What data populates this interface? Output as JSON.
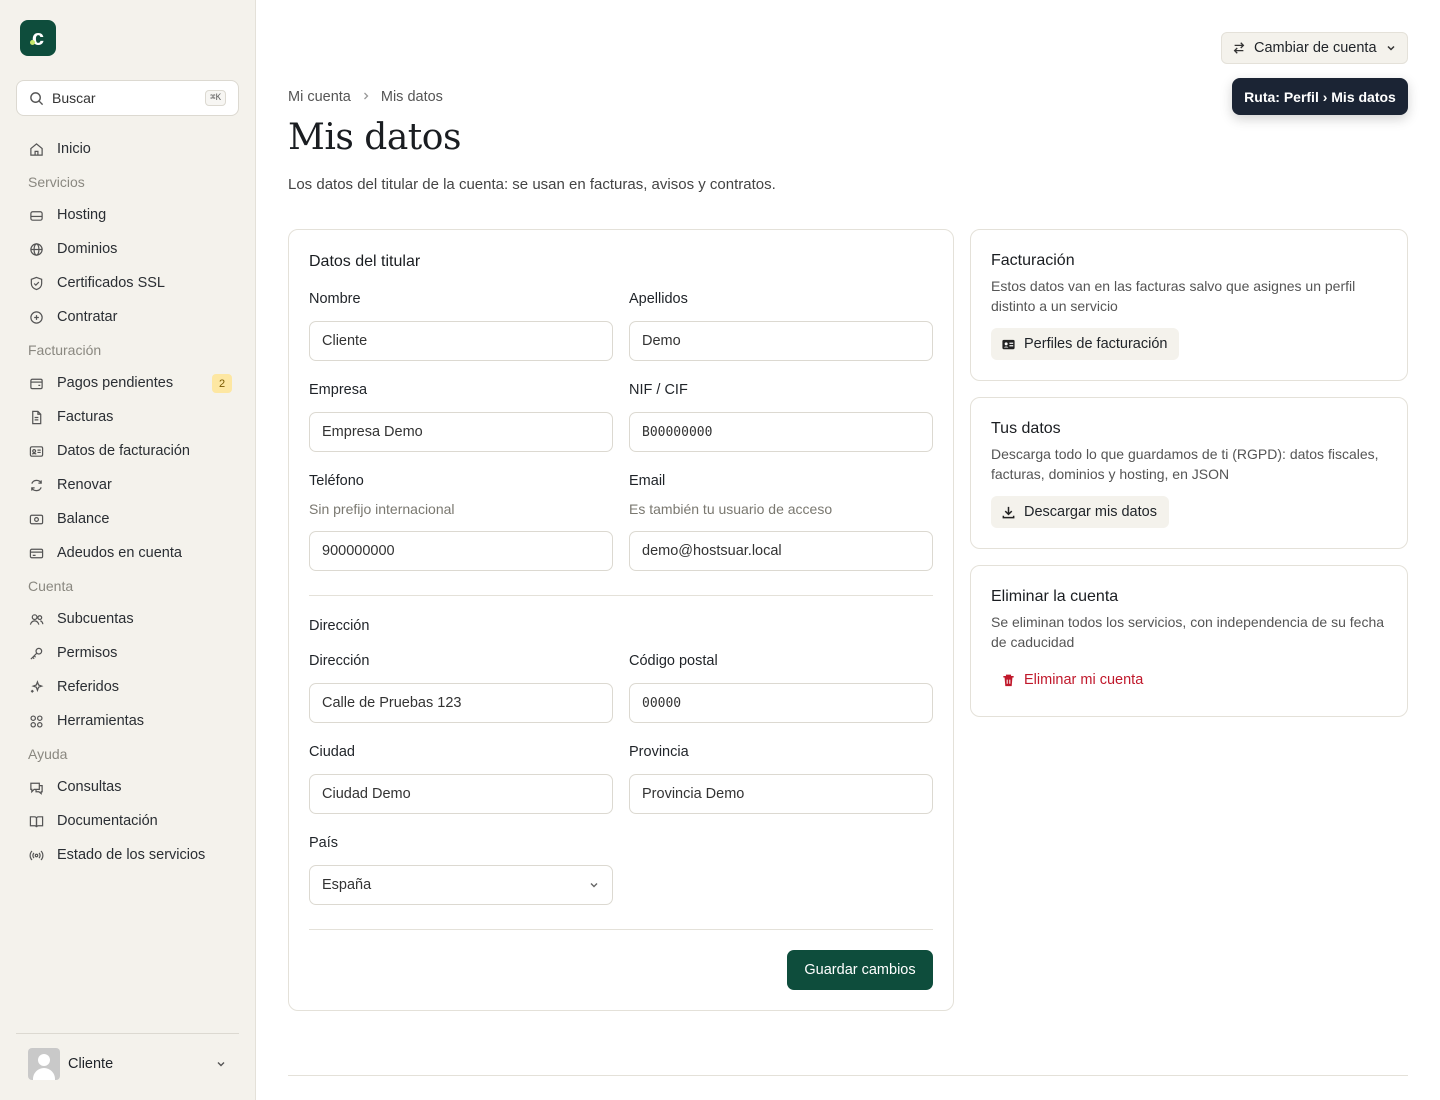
{
  "brand": {
    "logo_letter": "c",
    "accent": "#0e4d3c"
  },
  "search": {
    "placeholder": "Buscar",
    "shortcut": "⌘K"
  },
  "sidebar": {
    "home": "Inicio",
    "sections": {
      "servicios": "Servicios",
      "facturacion": "Facturación",
      "cuenta": "Cuenta",
      "ayuda": "Ayuda"
    },
    "items": {
      "hosting": "Hosting",
      "dominios": "Dominios",
      "ssl": "Certificados SSL",
      "contratar": "Contratar",
      "pagos": "Pagos pendientes",
      "pagos_badge": "2",
      "facturas": "Facturas",
      "datos_facturacion": "Datos de facturación",
      "renovar": "Renovar",
      "balance": "Balance",
      "adeudos": "Adeudos en cuenta",
      "subcuentas": "Subcuentas",
      "permisos": "Permisos",
      "referidos": "Referidos",
      "herramientas": "Herramientas",
      "consultas": "Consultas",
      "documentacion": "Documentación",
      "estado": "Estado de los servicios"
    },
    "user": {
      "name": "Cliente"
    }
  },
  "header": {
    "switch_account": "Cambiar de cuenta",
    "tooltip": "Ruta: Perfil › Mis datos"
  },
  "breadcrumb": {
    "parent": "Mi cuenta",
    "current": "Mis datos"
  },
  "page": {
    "title": "Mis datos",
    "subtitle": "Los datos del titular de la cuenta: se usan en facturas, avisos y contratos."
  },
  "form": {
    "title": "Datos del titular",
    "nombre": {
      "label": "Nombre",
      "value": "Cliente"
    },
    "apellidos": {
      "label": "Apellidos",
      "value": "Demo"
    },
    "empresa": {
      "label": "Empresa",
      "value": "Empresa Demo"
    },
    "nif": {
      "label": "NIF / CIF",
      "value": "B00000000"
    },
    "telefono": {
      "label": "Teléfono",
      "hint": "Sin prefijo internacional",
      "value": "900000000"
    },
    "email": {
      "label": "Email",
      "hint": "Es también tu usuario de acceso",
      "value": "demo@hostsuar.local"
    },
    "address_section": "Dirección",
    "direccion": {
      "label": "Dirección",
      "value": "Calle de Pruebas 123"
    },
    "cp": {
      "label": "Código postal",
      "value": "00000"
    },
    "ciudad": {
      "label": "Ciudad",
      "value": "Ciudad Demo"
    },
    "provincia": {
      "label": "Provincia",
      "value": "Provincia Demo"
    },
    "pais": {
      "label": "País",
      "value": "España"
    },
    "save": "Guardar cambios"
  },
  "cards": {
    "facturacion": {
      "title": "Facturación",
      "text": "Estos datos van en las facturas salvo que asignes un perfil distinto a un servicio",
      "button": "Perfiles de facturación"
    },
    "tus_datos": {
      "title": "Tus datos",
      "text": "Descarga todo lo que guardamos de ti (RGPD): datos fiscales, facturas, dominios y hosting, en JSON",
      "button": "Descargar mis datos"
    },
    "eliminar": {
      "title": "Eliminar la cuenta",
      "text": "Se eliminan todos los servicios, con independencia de su fecha de caducidad",
      "button": "Eliminar mi cuenta",
      "danger_color": "#c0182b"
    }
  }
}
